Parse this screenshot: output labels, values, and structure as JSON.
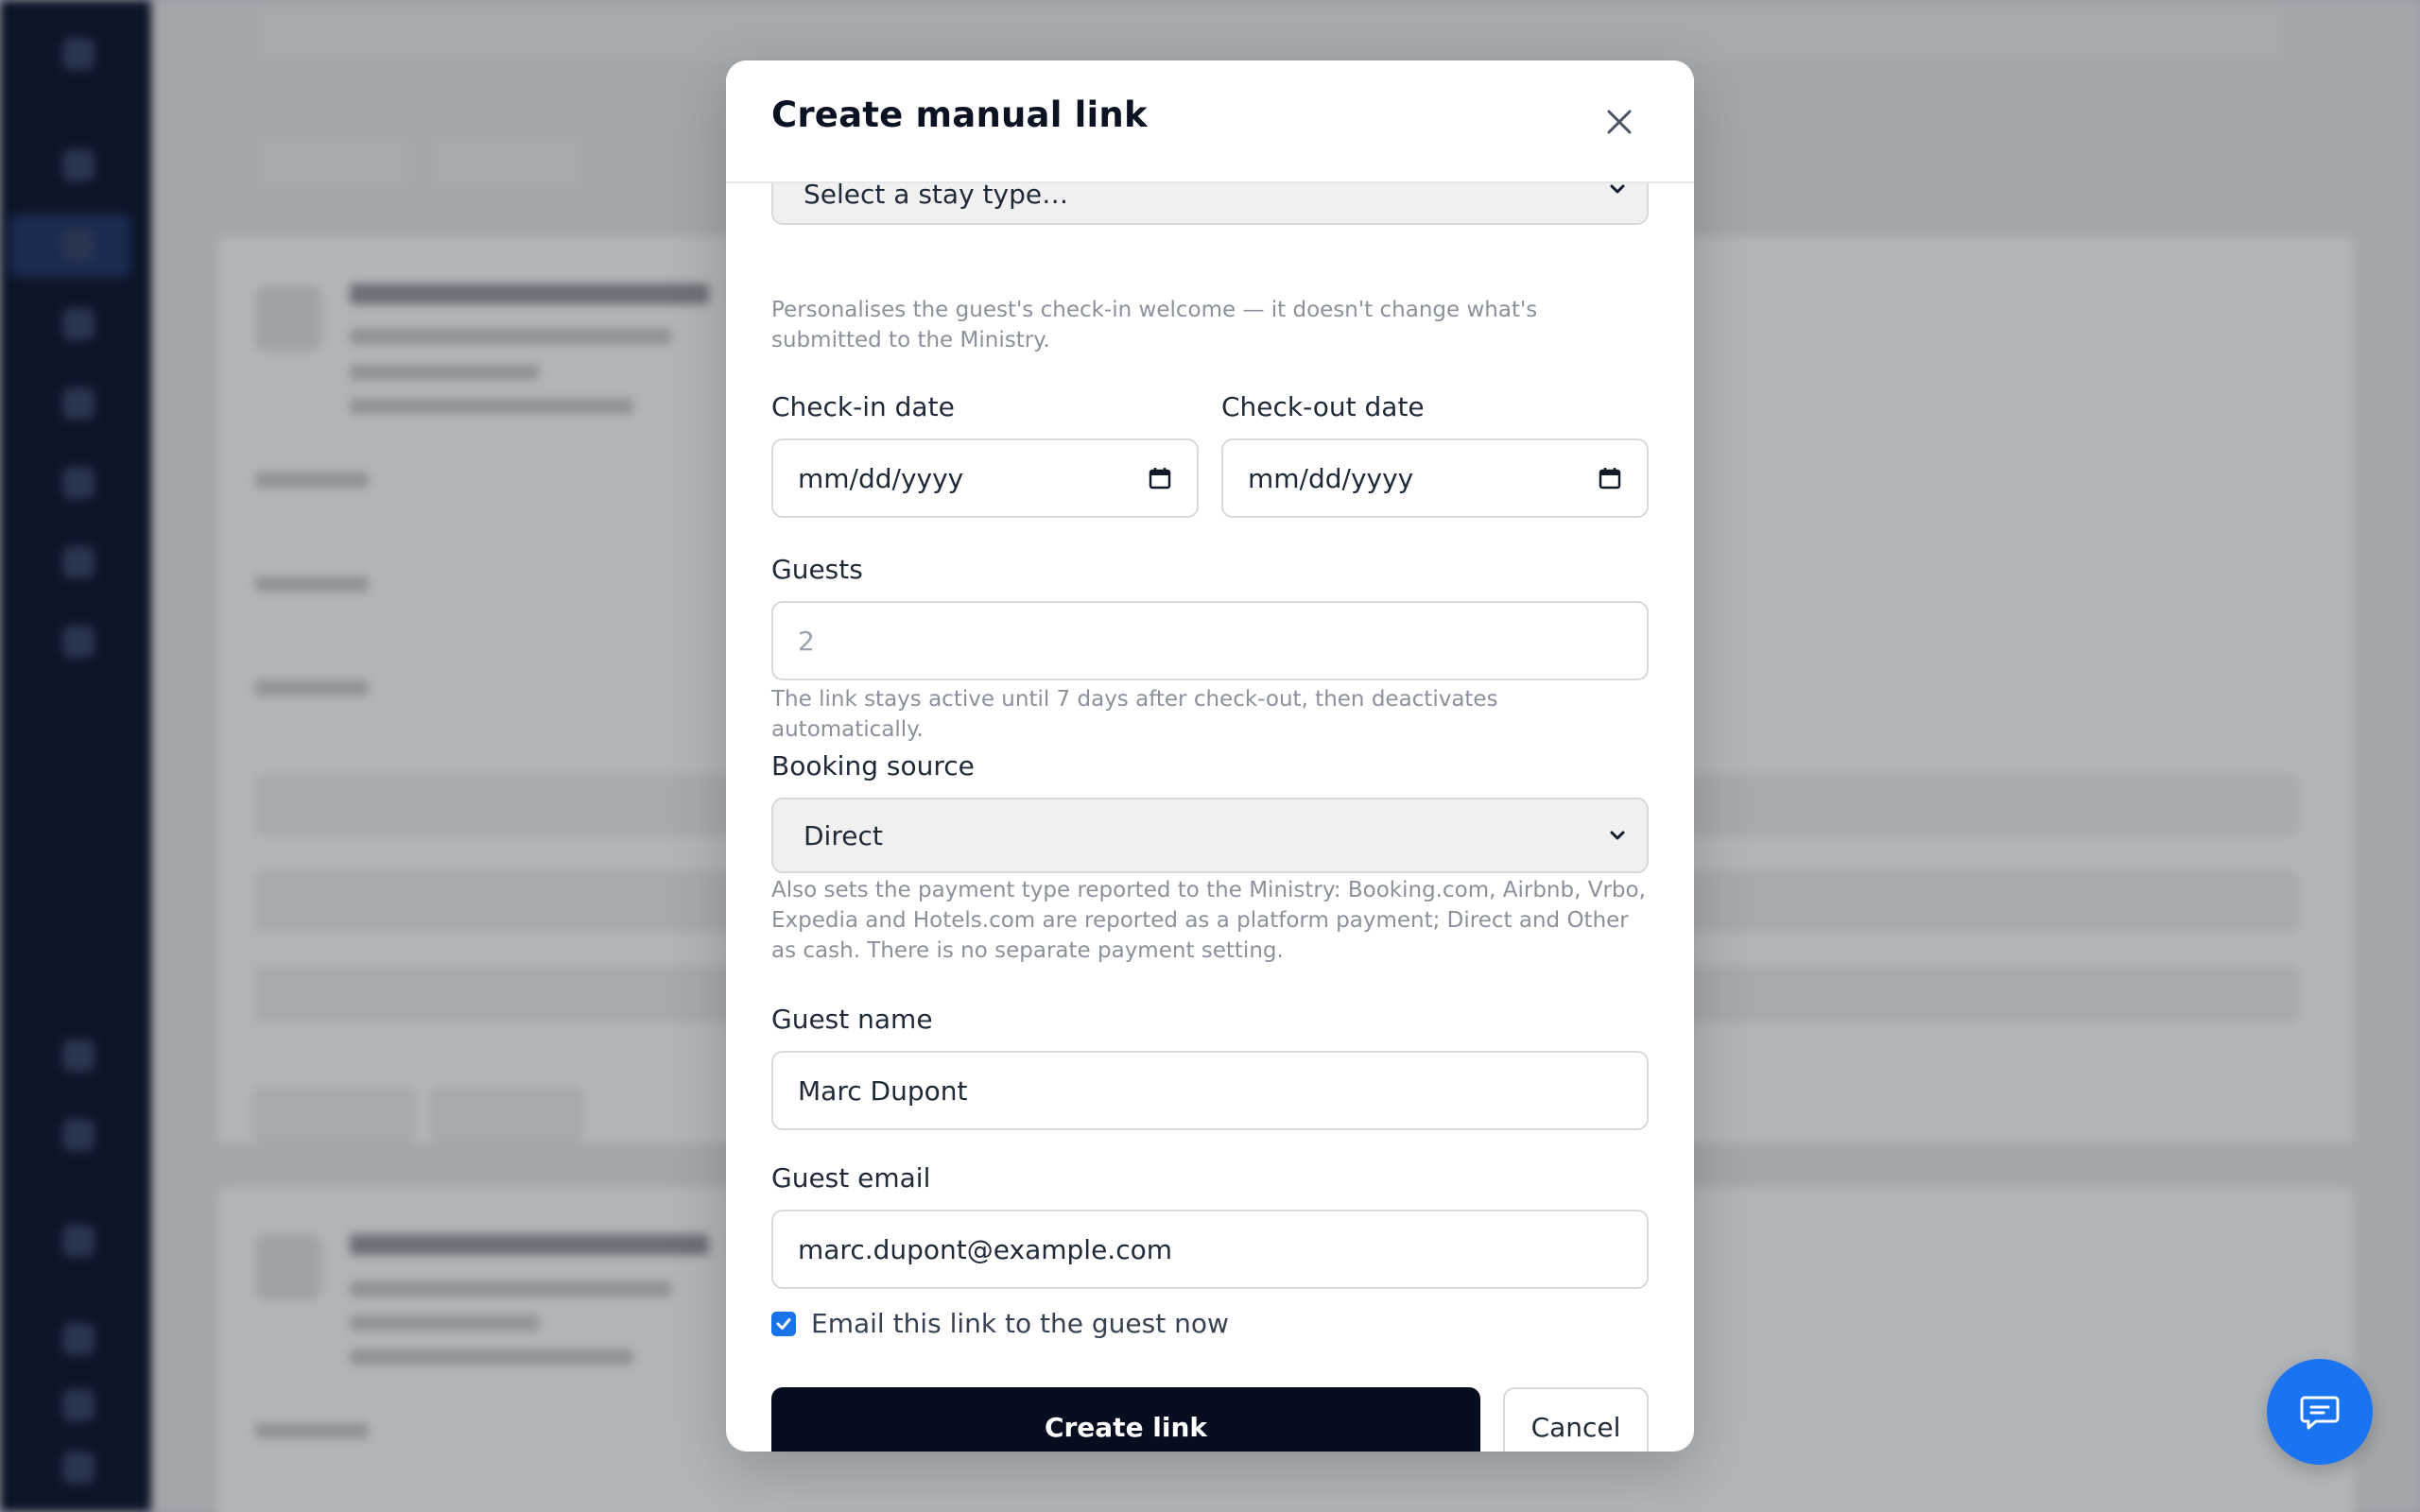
{
  "modal": {
    "title": "Create manual link",
    "stay_type": {
      "selected": "Select a stay type…",
      "help": "Personalises the guest's check-in welcome — it doesn't change what's submitted to the Ministry."
    },
    "checkin": {
      "label": "Check-in date",
      "value": "mm/dd/yyyy"
    },
    "checkout": {
      "label": "Check-out date",
      "value": "mm/dd/yyyy"
    },
    "guests": {
      "label": "Guests",
      "placeholder": "2",
      "help": "The link stays active until 7 days after check-out, then deactivates automatically."
    },
    "booking_source": {
      "label": "Booking source",
      "selected": "Direct",
      "help": "Also sets the payment type reported to the Ministry: Booking.com, Airbnb, Vrbo, Expedia and Hotels.com are reported as a platform payment; Direct and Other as cash. There is no separate payment setting."
    },
    "guest_name": {
      "label": "Guest name",
      "value": "Marc Dupont"
    },
    "guest_email": {
      "label": "Guest email",
      "value": "marc.dupont@example.com"
    },
    "email_now": {
      "label": "Email this link to the guest now",
      "checked": true
    },
    "create_label": "Create link",
    "cancel_label": "Cancel"
  },
  "icons": {
    "close": "close-icon",
    "calendar": "calendar-icon",
    "chevron": "chevron-down-icon",
    "chat": "chat-icon",
    "check": "check-icon"
  },
  "colors": {
    "primary_button": "#060d1f",
    "checkbox": "#1a73e8",
    "chat_fab": "#1a73f0",
    "sidebar": "#0c1528"
  }
}
